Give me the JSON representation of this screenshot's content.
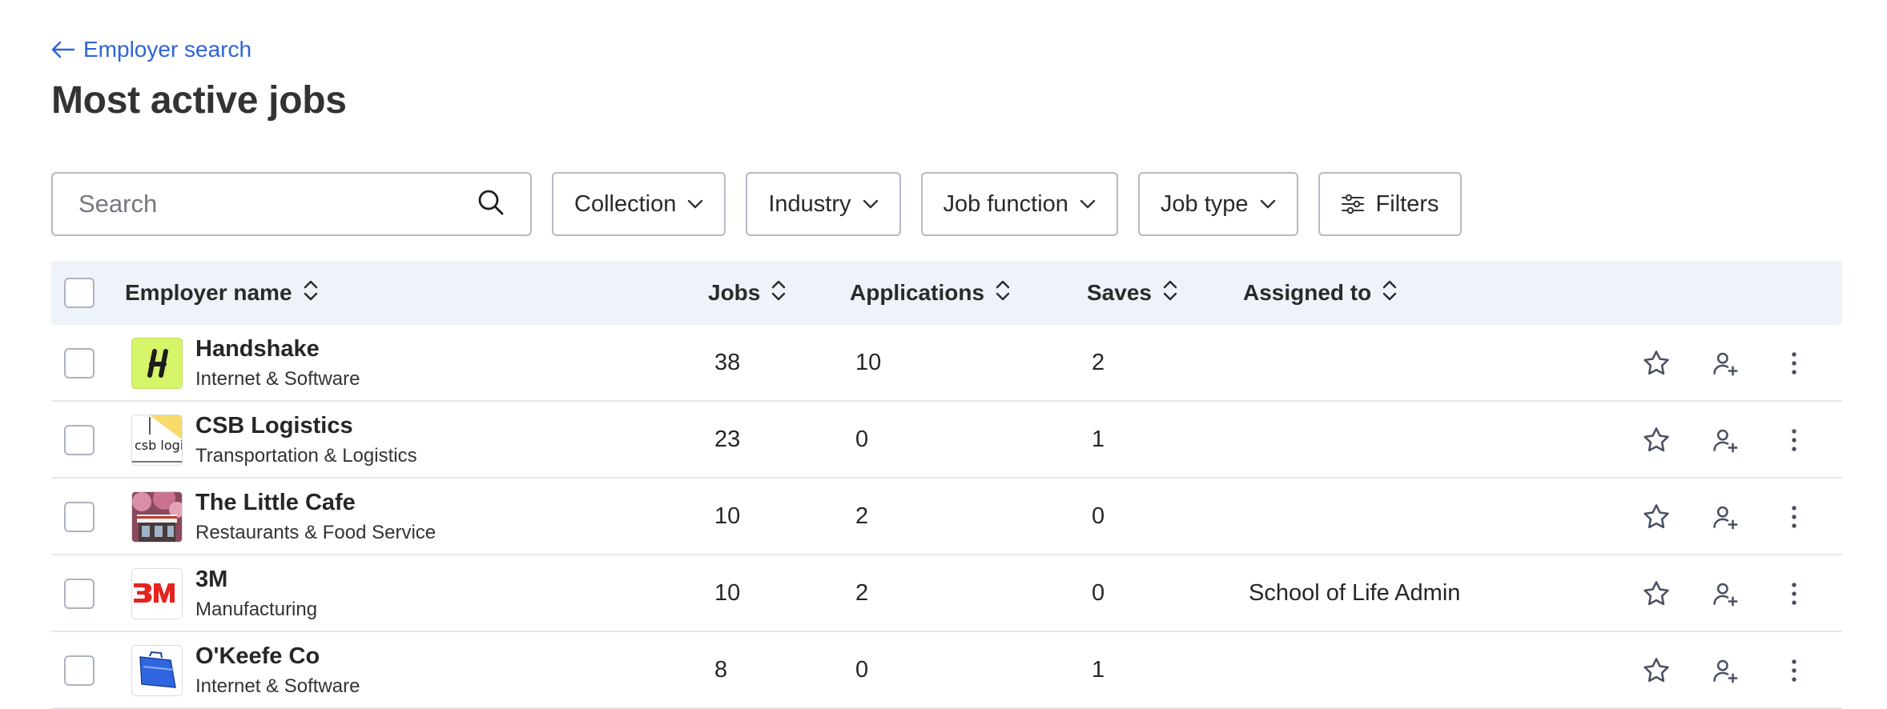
{
  "back_link": {
    "label": "Employer search",
    "icon": "arrow-left-icon"
  },
  "page_title": "Most active jobs",
  "search": {
    "placeholder": "Search",
    "value": ""
  },
  "filters": [
    {
      "name": "collection",
      "label": "Collection"
    },
    {
      "name": "industry",
      "label": "Industry"
    },
    {
      "name": "job-function",
      "label": "Job function"
    },
    {
      "name": "job-type",
      "label": "Job type"
    }
  ],
  "filters_button": {
    "label": "Filters"
  },
  "table": {
    "columns": {
      "employer": "Employer name",
      "jobs": "Jobs",
      "applications": "Applications",
      "saves": "Saves",
      "assigned": "Assigned to"
    },
    "rows": [
      {
        "name": "Handshake",
        "industry": "Internet & Software",
        "jobs": "38",
        "applications": "10",
        "saves": "2",
        "assigned": "",
        "logo": "handshake-logo"
      },
      {
        "name": "CSB Logistics",
        "industry": "Transportation & Logistics",
        "jobs": "23",
        "applications": "0",
        "saves": "1",
        "assigned": "",
        "logo": "csb-logistics-logo",
        "logo_text": "csb logistics"
      },
      {
        "name": "The Little Cafe",
        "industry": "Restaurants & Food Service",
        "jobs": "10",
        "applications": "2",
        "saves": "0",
        "assigned": "",
        "logo": "cafe-photo-logo"
      },
      {
        "name": "3M",
        "industry": "Manufacturing",
        "jobs": "10",
        "applications": "2",
        "saves": "0",
        "assigned": "School of Life Admin",
        "logo": "3m-logo"
      },
      {
        "name": "O'Keefe Co",
        "industry": "Internet & Software",
        "jobs": "8",
        "applications": "0",
        "saves": "1",
        "assigned": "",
        "logo": "okeefe-logo"
      }
    ]
  },
  "colors": {
    "link": "#2f63d9",
    "header_bg": "#eef2f9",
    "border": "#b5b9c7",
    "handshake_logo_bg": "#d7f56a",
    "3m_red": "#e4231f"
  }
}
